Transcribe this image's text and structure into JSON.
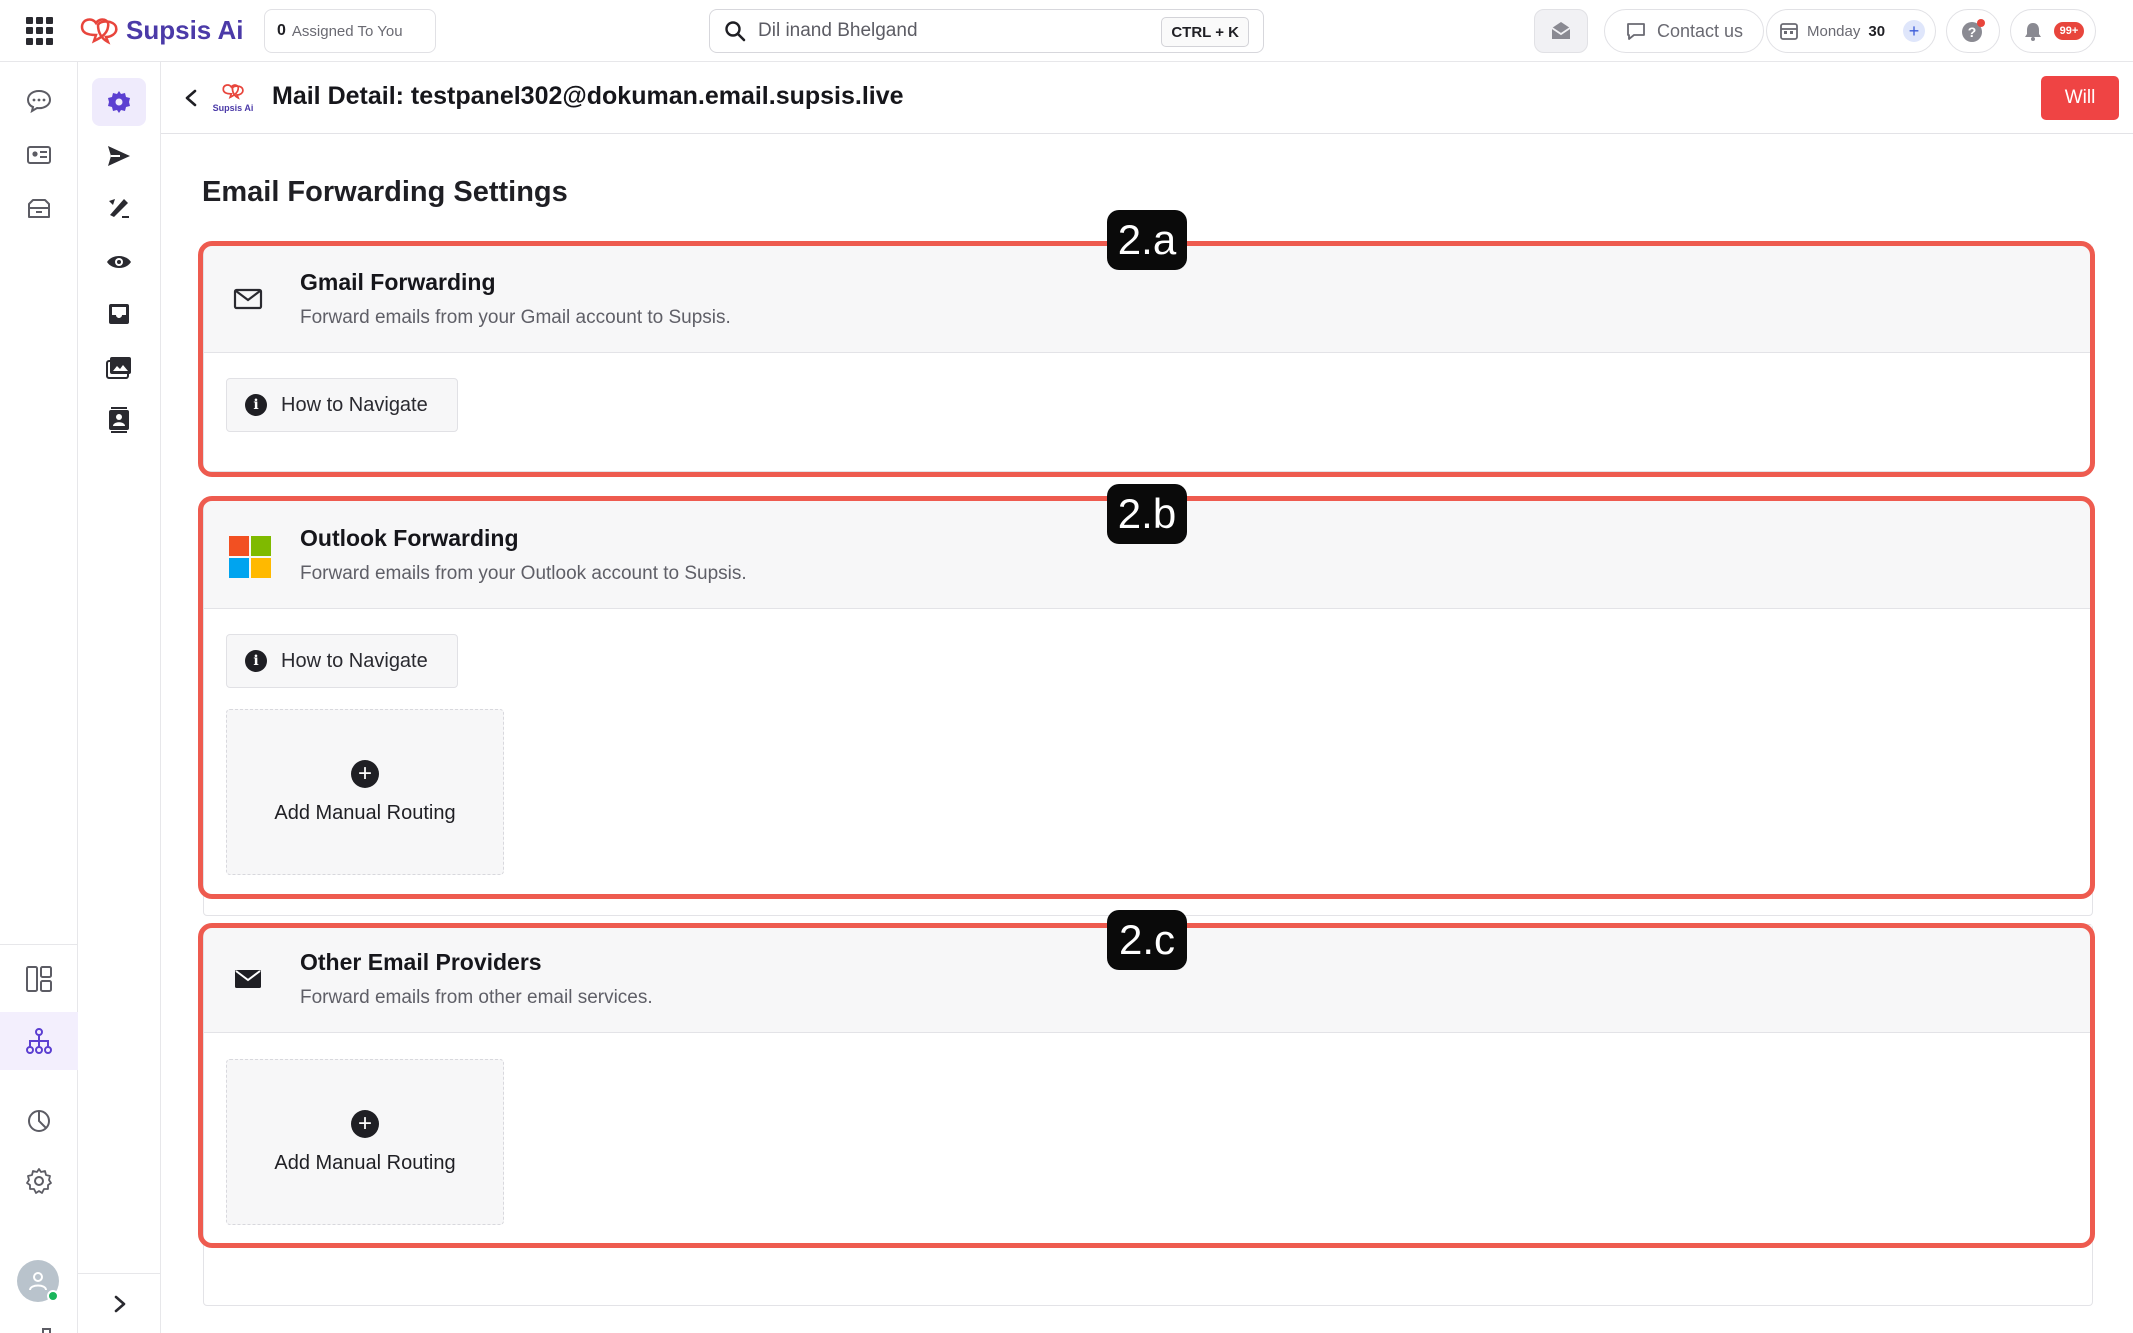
{
  "topbar": {
    "brand": "Supsis Ai",
    "assigned_count": "0",
    "assigned_label": "Assigned To You",
    "search_value": "Dil inand Bhelgand",
    "search_shortcut": "CTRL + K",
    "contact_label": "Contact us",
    "date_day": "Monday",
    "date_num": "30",
    "notif_badge": "99+"
  },
  "header": {
    "mini_logo": "Supsis Ai",
    "title": "Mail Detail: testpanel302@dokuman.email.supsis.live",
    "action_label": "Will"
  },
  "content": {
    "section_title": "Email Forwarding Settings",
    "cards": [
      {
        "title": "Gmail Forwarding",
        "desc": "Forward emails from your Gmail account to Supsis.",
        "nav_label": "How to Navigate"
      },
      {
        "title": "Outlook Forwarding",
        "desc": "Forward emails from your Outlook account to Supsis.",
        "nav_label": "How to Navigate",
        "add_label": "Add Manual Routing"
      },
      {
        "title": "Other Email Providers",
        "desc": "Forward emails from other email services.",
        "add_label": "Add Manual Routing"
      }
    ]
  },
  "annotations": [
    "2.a",
    "2.b",
    "2.c"
  ],
  "colors": {
    "accent": "#4b3aa8",
    "danger": "#ef4444",
    "annotation_frame": "#ee5b4f"
  },
  "icons": {
    "apps": "apps-grid-icon",
    "gmail": "envelope-outline-icon",
    "outlook": "microsoft-logo-icon",
    "other": "envelope-filled-icon"
  }
}
